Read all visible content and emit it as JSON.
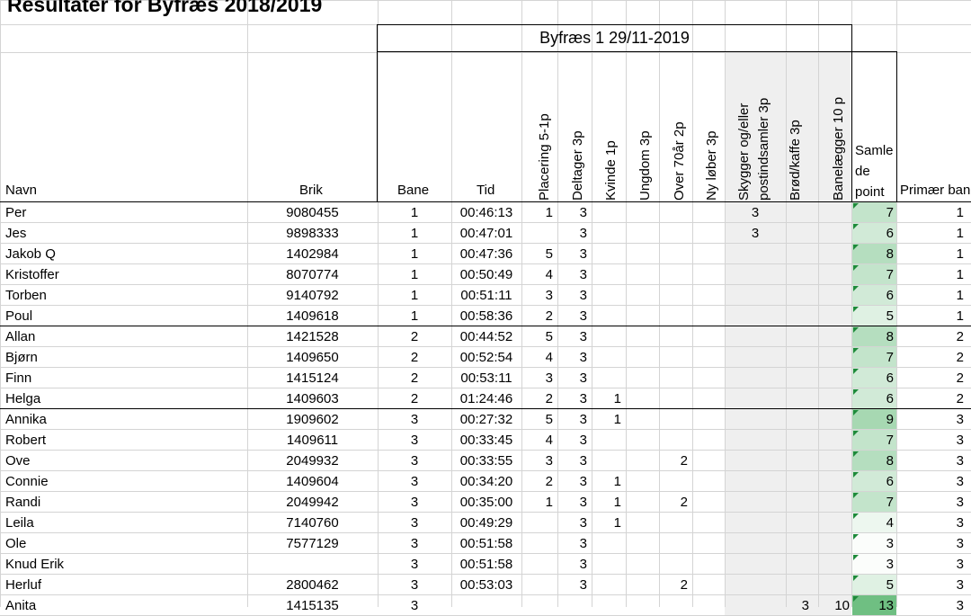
{
  "title": "Resultater for Byfræs 2018/2019",
  "group_header": "Byfræs 1 29/11-2019",
  "columns": {
    "navn": "Navn",
    "brik": "Brik",
    "bane": "Bane",
    "tid": "Tid",
    "placering": "Placering 5-1p",
    "deltager": "Deltager 3p",
    "kvinde": "Kvinde 1p",
    "ungdom": "Ungdom 3p",
    "over70": "Over 70år 2p",
    "nyloeber": "Ny løber 3p",
    "skygger_line1": "Skygger og/eller",
    "skygger_line2": "postindsamler 3p",
    "broed": "Brød/kaffe 3p",
    "banelaegger": "Banelægger 10 p",
    "samlede_line1": "Samle",
    "samlede_line2": "de",
    "samlede_line3": "point",
    "primaer": "Primær bane"
  },
  "colors": {
    "samle_max": "#6fbf82",
    "samle_min": "#fbfdfb",
    "shade": "#efefef",
    "grid": "#d4d4d4"
  },
  "rows": [
    {
      "navn": "Per",
      "brik": "9080455",
      "bane": "1",
      "tid": "00:46:13",
      "placering": "1",
      "deltager": "3",
      "kvinde": "",
      "ungdom": "",
      "over70": "",
      "nyloeber": "",
      "skygger": "3",
      "broed": "",
      "banelaegger": "",
      "samlede": "7",
      "primaer": "1"
    },
    {
      "navn": "Jes",
      "brik": "9898333",
      "bane": "1",
      "tid": "00:47:01",
      "placering": "",
      "deltager": "3",
      "kvinde": "",
      "ungdom": "",
      "over70": "",
      "nyloeber": "",
      "skygger": "3",
      "broed": "",
      "banelaegger": "",
      "samlede": "6",
      "primaer": "1"
    },
    {
      "navn": "Jakob Q",
      "brik": "1402984",
      "bane": "1",
      "tid": "00:47:36",
      "placering": "5",
      "deltager": "3",
      "kvinde": "",
      "ungdom": "",
      "over70": "",
      "nyloeber": "",
      "skygger": "",
      "broed": "",
      "banelaegger": "",
      "samlede": "8",
      "primaer": "1"
    },
    {
      "navn": "Kristoffer",
      "brik": "8070774",
      "bane": "1",
      "tid": "00:50:49",
      "placering": "4",
      "deltager": "3",
      "kvinde": "",
      "ungdom": "",
      "over70": "",
      "nyloeber": "",
      "skygger": "",
      "broed": "",
      "banelaegger": "",
      "samlede": "7",
      "primaer": "1"
    },
    {
      "navn": "Torben",
      "brik": "9140792",
      "bane": "1",
      "tid": "00:51:11",
      "placering": "3",
      "deltager": "3",
      "kvinde": "",
      "ungdom": "",
      "over70": "",
      "nyloeber": "",
      "skygger": "",
      "broed": "",
      "banelaegger": "",
      "samlede": "6",
      "primaer": "1"
    },
    {
      "navn": "Poul",
      "brik": "1409618",
      "bane": "1",
      "tid": "00:58:36",
      "placering": "2",
      "deltager": "3",
      "kvinde": "",
      "ungdom": "",
      "over70": "",
      "nyloeber": "",
      "skygger": "",
      "broed": "",
      "banelaegger": "",
      "samlede": "5",
      "primaer": "1"
    },
    {
      "navn": "Allan",
      "brik": "1421528",
      "bane": "2",
      "tid": "00:44:52",
      "placering": "5",
      "deltager": "3",
      "kvinde": "",
      "ungdom": "",
      "over70": "",
      "nyloeber": "",
      "skygger": "",
      "broed": "",
      "banelaegger": "",
      "samlede": "8",
      "primaer": "2"
    },
    {
      "navn": "Bjørn",
      "brik": "1409650",
      "bane": "2",
      "tid": "00:52:54",
      "placering": "4",
      "deltager": "3",
      "kvinde": "",
      "ungdom": "",
      "over70": "",
      "nyloeber": "",
      "skygger": "",
      "broed": "",
      "banelaegger": "",
      "samlede": "7",
      "primaer": "2"
    },
    {
      "navn": "Finn",
      "brik": "1415124",
      "bane": "2",
      "tid": "00:53:11",
      "placering": "3",
      "deltager": "3",
      "kvinde": "",
      "ungdom": "",
      "over70": "",
      "nyloeber": "",
      "skygger": "",
      "broed": "",
      "banelaegger": "",
      "samlede": "6",
      "primaer": "2"
    },
    {
      "navn": "Helga",
      "brik": "1409603",
      "bane": "2",
      "tid": "01:24:46",
      "placering": "2",
      "deltager": "3",
      "kvinde": "1",
      "ungdom": "",
      "over70": "",
      "nyloeber": "",
      "skygger": "",
      "broed": "",
      "banelaegger": "",
      "samlede": "6",
      "primaer": "2"
    },
    {
      "navn": "Annika",
      "brik": "1909602",
      "bane": "3",
      "tid": "00:27:32",
      "placering": "5",
      "deltager": "3",
      "kvinde": "1",
      "ungdom": "",
      "over70": "",
      "nyloeber": "",
      "skygger": "",
      "broed": "",
      "banelaegger": "",
      "samlede": "9",
      "primaer": "3"
    },
    {
      "navn": "Robert",
      "brik": "1409611",
      "bane": "3",
      "tid": "00:33:45",
      "placering": "4",
      "deltager": "3",
      "kvinde": "",
      "ungdom": "",
      "over70": "",
      "nyloeber": "",
      "skygger": "",
      "broed": "",
      "banelaegger": "",
      "samlede": "7",
      "primaer": "3"
    },
    {
      "navn": "Ove",
      "brik": "2049932",
      "bane": "3",
      "tid": "00:33:55",
      "placering": "3",
      "deltager": "3",
      "kvinde": "",
      "ungdom": "",
      "over70": "2",
      "nyloeber": "",
      "skygger": "",
      "broed": "",
      "banelaegger": "",
      "samlede": "8",
      "primaer": "3"
    },
    {
      "navn": "Connie",
      "brik": "1409604",
      "bane": "3",
      "tid": "00:34:20",
      "placering": "2",
      "deltager": "3",
      "kvinde": "1",
      "ungdom": "",
      "over70": "",
      "nyloeber": "",
      "skygger": "",
      "broed": "",
      "banelaegger": "",
      "samlede": "6",
      "primaer": "3"
    },
    {
      "navn": "Randi",
      "brik": "2049942",
      "bane": "3",
      "tid": "00:35:00",
      "placering": "1",
      "deltager": "3",
      "kvinde": "1",
      "ungdom": "",
      "over70": "2",
      "nyloeber": "",
      "skygger": "",
      "broed": "",
      "banelaegger": "",
      "samlede": "7",
      "primaer": "3"
    },
    {
      "navn": "Leila",
      "brik": "7140760",
      "bane": "3",
      "tid": "00:49:29",
      "placering": "",
      "deltager": "3",
      "kvinde": "1",
      "ungdom": "",
      "over70": "",
      "nyloeber": "",
      "skygger": "",
      "broed": "",
      "banelaegger": "",
      "samlede": "4",
      "primaer": "3"
    },
    {
      "navn": "Ole",
      "brik": "7577129",
      "bane": "3",
      "tid": "00:51:58",
      "placering": "",
      "deltager": "3",
      "kvinde": "",
      "ungdom": "",
      "over70": "",
      "nyloeber": "",
      "skygger": "",
      "broed": "",
      "banelaegger": "",
      "samlede": "3",
      "primaer": "3"
    },
    {
      "navn": "Knud Erik",
      "brik": "",
      "bane": "3",
      "tid": "00:51:58",
      "placering": "",
      "deltager": "3",
      "kvinde": "",
      "ungdom": "",
      "over70": "",
      "nyloeber": "",
      "skygger": "",
      "broed": "",
      "banelaegger": "",
      "samlede": "3",
      "primaer": "3"
    },
    {
      "navn": "Herluf",
      "brik": "2800462",
      "bane": "3",
      "tid": "00:53:03",
      "placering": "",
      "deltager": "3",
      "kvinde": "",
      "ungdom": "",
      "over70": "2",
      "nyloeber": "",
      "skygger": "",
      "broed": "",
      "banelaegger": "",
      "samlede": "5",
      "primaer": "3"
    },
    {
      "navn": "Anita",
      "brik": "1415135",
      "bane": "3",
      "tid": "",
      "placering": "",
      "deltager": "",
      "kvinde": "",
      "ungdom": "",
      "over70": "",
      "nyloeber": "",
      "skygger": "",
      "broed": "3",
      "banelaegger": "10",
      "samlede": "13",
      "primaer": "3"
    }
  ]
}
